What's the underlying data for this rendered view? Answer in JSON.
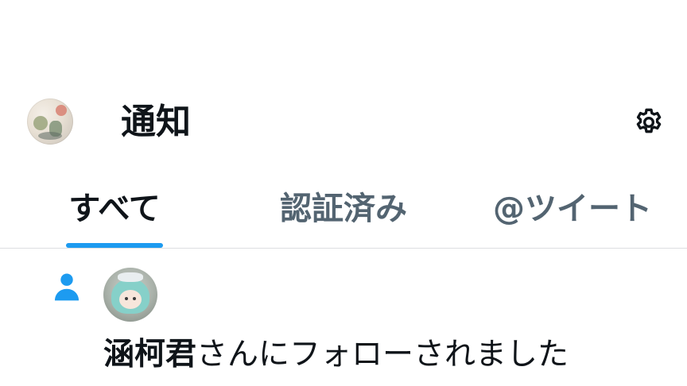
{
  "header": {
    "title": "通知",
    "avatar_icon": "profile-avatar",
    "settings_icon": "gear-icon"
  },
  "tabs": [
    {
      "label": "すべて",
      "active": true
    },
    {
      "label": "認証済み",
      "active": false
    },
    {
      "label": "@ツイート",
      "active": false
    }
  ],
  "notification": {
    "type_icon": "person-icon",
    "user_name": "涵柯君",
    "message": "さんにフォローされました"
  },
  "colors": {
    "accent": "#1d9bf0",
    "text_primary": "#0f1419",
    "text_secondary": "#536471",
    "divider": "#dddfe2"
  }
}
